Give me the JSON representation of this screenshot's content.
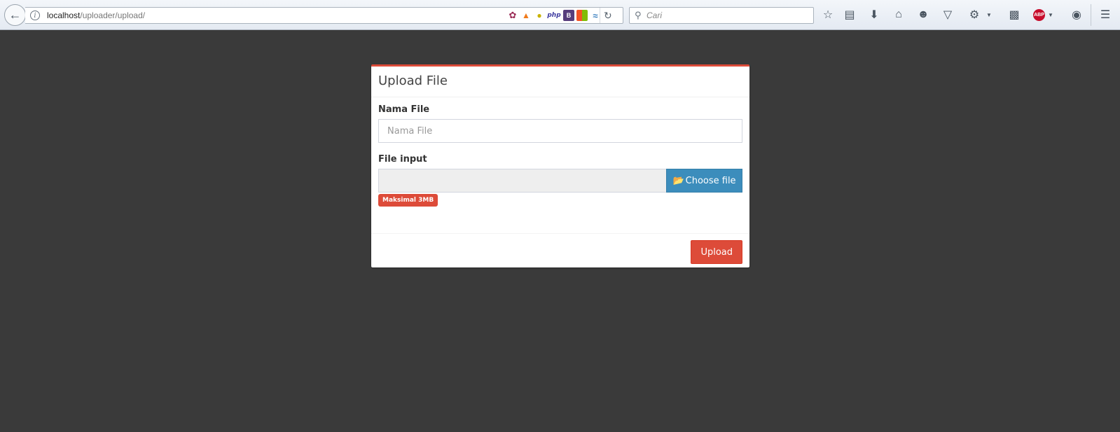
{
  "browser": {
    "url_host": "localhost",
    "url_path": "/uploader/upload/",
    "search_placeholder": "Cari",
    "extensions": [
      "leaf-icon",
      "fire-icon",
      "lock-icon",
      "php",
      "B",
      "windows-icon",
      "wave-icon"
    ],
    "extension_php_label": "php",
    "extension_b_label": "B",
    "abp_label": "ABP"
  },
  "panel": {
    "title": "Upload File",
    "accent_color": "#dd4b39",
    "name_label": "Nama File",
    "name_placeholder": "Nama File",
    "name_value": "",
    "file_label": "File input",
    "choose_button": "Choose file",
    "max_badge": "Maksimal 3MB",
    "upload_button": "Upload"
  },
  "colors": {
    "background": "#3a3a3a",
    "primary": "#3c8dbc",
    "danger": "#dd4b39"
  }
}
